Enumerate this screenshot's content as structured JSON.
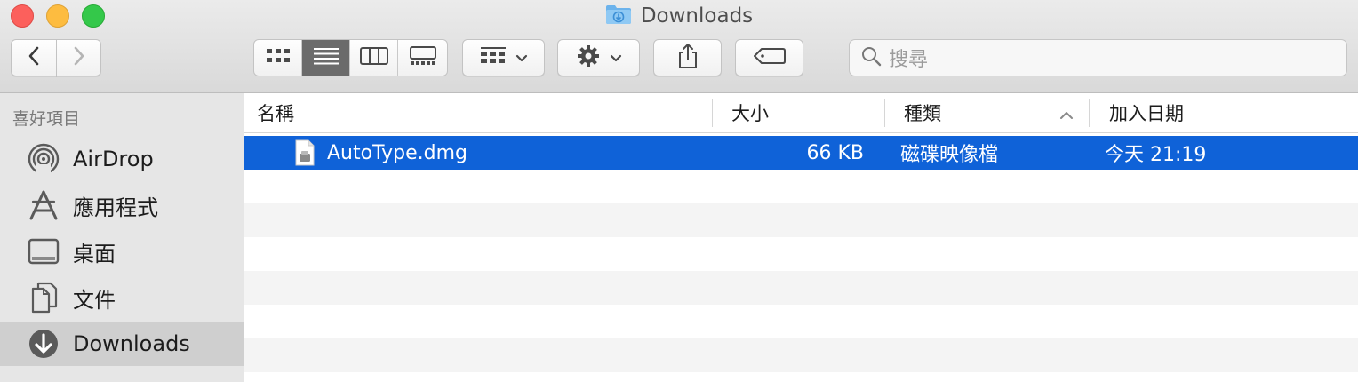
{
  "window": {
    "title": "Downloads"
  },
  "toolbar": {
    "group_icon": "group-icon",
    "action_icon": "gear-icon",
    "share_icon": "share-icon",
    "tag_icon": "tag-icon"
  },
  "search": {
    "placeholder": "搜尋"
  },
  "sidebar": {
    "section_title": "喜好項目",
    "items": [
      {
        "label": "AirDrop",
        "icon": "airdrop-icon"
      },
      {
        "label": "應用程式",
        "icon": "applications-icon"
      },
      {
        "label": "桌面",
        "icon": "desktop-icon"
      },
      {
        "label": "文件",
        "icon": "documents-icon"
      },
      {
        "label": "Downloads",
        "icon": "downloads-icon",
        "active": true
      }
    ]
  },
  "list": {
    "columns": {
      "name": "名稱",
      "size": "大小",
      "kind": "種類",
      "date": "加入日期"
    },
    "sorted_by": "kind",
    "files": [
      {
        "name": "AutoType.dmg",
        "size": "66 KB",
        "kind": "磁碟映像檔",
        "date": "今天 21:19",
        "selected": true
      }
    ]
  },
  "colors": {
    "selection": "#0f62d8",
    "sidebar_bg": "#e6e6e6"
  }
}
